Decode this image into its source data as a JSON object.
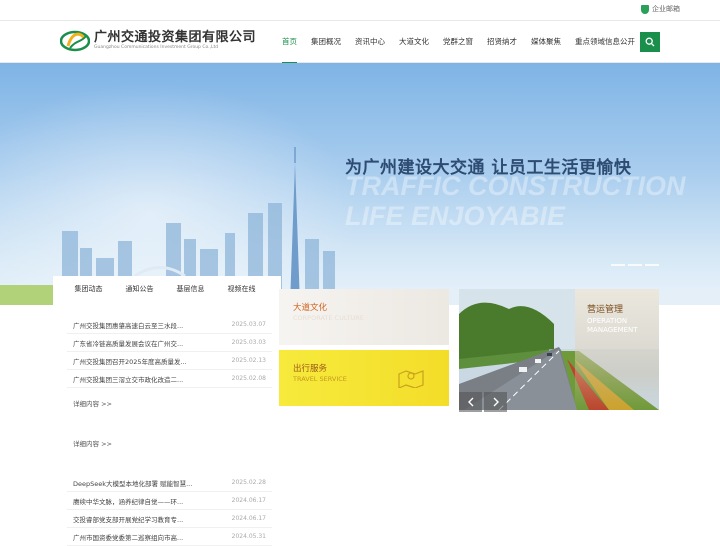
{
  "topbar": {
    "mail_label": "企业邮箱"
  },
  "logo": {
    "company_name": "广州交通投资集团有限公司",
    "company_en": "Guangzhou Communications Investment Group Co.,Ltd"
  },
  "nav": {
    "items": [
      "首页",
      "集团概况",
      "资讯中心",
      "大道文化",
      "党群之窗",
      "招贤纳才",
      "媒体聚焦",
      "重点领域信息公开"
    ]
  },
  "banner": {
    "slogan": "为广州建设大交通 让员工生活更愉快",
    "slogan_en_1": "TRAFFIC CONSTRUCTION",
    "slogan_en_2": "LIFE ENJOYABIE"
  },
  "news": {
    "tabs": [
      "集团动态",
      "通知公告",
      "基层信息",
      "视频在线"
    ],
    "items_top": [
      {
        "title": "广州交投集团惠肇高速白云至三水段...",
        "date": "2025.03.07"
      },
      {
        "title": "广东省冷链高质量发展会议在广州交...",
        "date": "2025.03.03"
      },
      {
        "title": "广州交投集团召开2025年度高质量发...",
        "date": "2025.02.13"
      },
      {
        "title": "广州交投集团三滘立交市政化改造二...",
        "date": "2025.02.08"
      }
    ],
    "more_1": "详细内容 >>",
    "more_2": "详细内容 >>",
    "items_bottom": [
      {
        "title": "DeepSeek大模型本地化部署 赋能智慧...",
        "date": "2025.02.28"
      },
      {
        "title": "赓续中华文脉，涵养纪律自觉——环...",
        "date": "2024.06.17"
      },
      {
        "title": "交投睿部党支部开展党纪学习教育专...",
        "date": "2024.06.17"
      },
      {
        "title": "广州市国资委党委第二巡察组向市高...",
        "date": "2024.05.31"
      }
    ]
  },
  "cards": {
    "culture_cn": "大道文化",
    "culture_en": "CORPORATE CULTURE",
    "travel_cn": "出行服务",
    "travel_en": "TRAVEL SERVICE"
  },
  "operation": {
    "cn": "营运管理",
    "en_1": "OPERATION",
    "en_2": "MANAGEMENT"
  },
  "colors": {
    "brand_green": "#1a8f4c",
    "card_yellow": "#f5e232",
    "slogan_blue": "#2e4b72"
  }
}
